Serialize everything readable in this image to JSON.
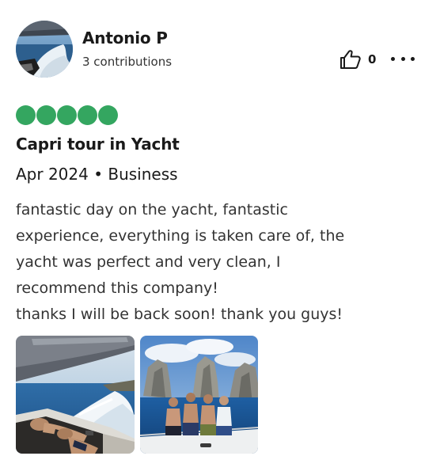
{
  "review": {
    "author": {
      "name": "Antonio P",
      "contributions": "3 contributions",
      "avatar_icon": "avatar-photo-boat-wake"
    },
    "helpful": {
      "icon": "thumbs-up-icon",
      "count": "0"
    },
    "more_icon": "more-options-icon",
    "rating": {
      "value": 5,
      "max": 5,
      "color": "#34a660"
    },
    "title": "Capri tour in Yacht",
    "meta": "Apr 2024 • Business",
    "body_lines": [
      "fantastic day on the yacht, fantastic",
      "experience, everything is taken care of, the",
      "yacht was perfect and very clean, I",
      "recommend this company!",
      "thanks I will be back soon! thank you guys!"
    ],
    "photos": [
      {
        "name": "review-photo-yacht-deck"
      },
      {
        "name": "review-photo-group-faraglioni"
      }
    ]
  }
}
